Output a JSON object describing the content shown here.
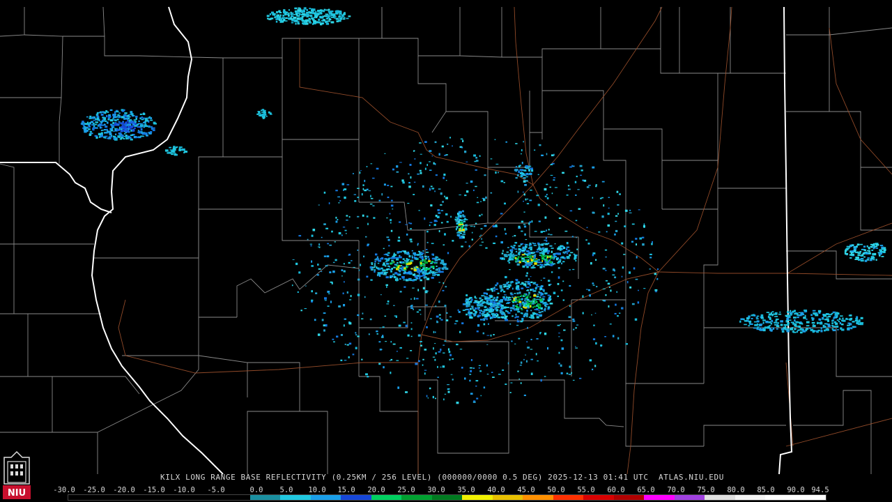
{
  "caption": "KILX LONG RANGE BASE REFLECTIVITY (0.25KM / 256 LEVEL) (000000/0000 0.5 DEG) 2025-12-13 01:41 UTC  ATLAS.NIU.EDU",
  "scale_labels": [
    "-30.0",
    "-25.0",
    "-20.0",
    "-15.0",
    "-10.0",
    "-5.0",
    "0.0",
    "5.0",
    "10.0",
    "15.0",
    "20.0",
    "25.0",
    "30.0",
    "35.0",
    "40.0",
    "45.0",
    "50.0",
    "55.0",
    "60.0",
    "65.0",
    "70.0",
    "75.0",
    "80.0",
    "85.0",
    "90.0",
    "94.5"
  ],
  "scale_colors": [
    "#000000",
    "#000000",
    "#000000",
    "#000000",
    "#000000",
    "#000000",
    "#1a8fa0",
    "#20c8e0",
    "#1a9ee8",
    "#1646d8",
    "#00d060",
    "#00a030",
    "#007a20",
    "#f0f000",
    "#e8c000",
    "#ff9000",
    "#ff3000",
    "#d80000",
    "#b00000",
    "#ff00ff",
    "#a040e0",
    "#e0e0e0",
    "#f4f4f4",
    "#ffffff",
    "#ffffff"
  ],
  "logo": {
    "text": "NIU",
    "color": "#c8102e"
  },
  "colors": {
    "background": "#000000",
    "county_border": "#8a8a8a",
    "state_border": "#ffffff",
    "highway": "#a0522d"
  }
}
